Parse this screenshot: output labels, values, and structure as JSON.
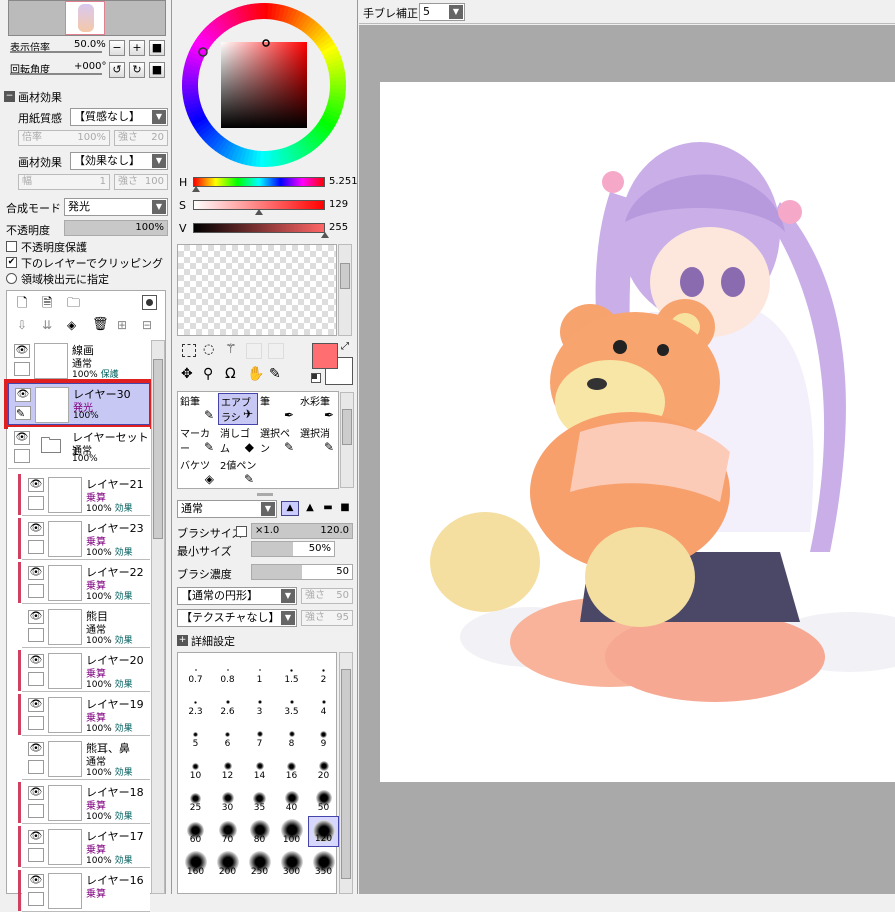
{
  "navigator": {
    "zoom_label": "表示倍率",
    "zoom_value": "50.0%",
    "rotate_label": "回転角度",
    "rotate_value": "+000°"
  },
  "texture": {
    "header": "画材効果",
    "paper_label": "用紙質感",
    "paper_value": "【質感なし】",
    "rate_label": "倍率",
    "rate_value": "100%",
    "strength_label": "強さ",
    "strength_value": "20",
    "effect_label": "画材効果",
    "effect_value": "【効果なし】",
    "width_label": "幅",
    "width_value": "1",
    "strength2_label": "強さ",
    "strength2_value": "100"
  },
  "layer_props": {
    "blend_label": "合成モード",
    "blend_value": "発光",
    "opacity_label": "不透明度",
    "opacity_value": "100%",
    "protect_opacity": "不透明度保護",
    "clip_lower": "下のレイヤーでクリッピング",
    "selection_source": "領域検出元に指定"
  },
  "layers": [
    {
      "name": "線画",
      "mode": "通常",
      "opacity": "100%",
      "extra": "保護"
    },
    {
      "name": "レイヤー30",
      "mode": "発光",
      "opacity": "100%",
      "extra": ""
    },
    {
      "name": "レイヤーセット1",
      "mode": "通常",
      "opacity": "100%",
      "extra": ""
    },
    {
      "name": "レイヤー21",
      "mode": "乗算",
      "opacity": "100%",
      "extra": "効果"
    },
    {
      "name": "レイヤー23",
      "mode": "乗算",
      "opacity": "100%",
      "extra": "効果"
    },
    {
      "name": "レイヤー22",
      "mode": "乗算",
      "opacity": "100%",
      "extra": "効果"
    },
    {
      "name": "熊目",
      "mode": "通常",
      "opacity": "100%",
      "extra": "効果"
    },
    {
      "name": "レイヤー20",
      "mode": "乗算",
      "opacity": "100%",
      "extra": "効果"
    },
    {
      "name": "レイヤー19",
      "mode": "乗算",
      "opacity": "100%",
      "extra": "効果"
    },
    {
      "name": "熊耳、鼻",
      "mode": "通常",
      "opacity": "100%",
      "extra": "効果"
    },
    {
      "name": "レイヤー18",
      "mode": "乗算",
      "opacity": "100%",
      "extra": "効果"
    },
    {
      "name": "レイヤー17",
      "mode": "乗算",
      "opacity": "100%",
      "extra": "効果"
    },
    {
      "name": "レイヤー16",
      "mode": "乗算",
      "opacity": "",
      "extra": ""
    }
  ],
  "color": {
    "h_label": "H",
    "h_value": "5.251",
    "h_level": 0.02,
    "s_label": "S",
    "s_value": "129",
    "s_level": 0.5,
    "v_label": "V",
    "v_value": "255",
    "v_level": 1.0,
    "fg_color": "#ff6f72",
    "bg_color": "#ffffff"
  },
  "tools": [
    {
      "label": "鉛筆",
      "icon": "pencil-icon",
      "glyph": "✎"
    },
    {
      "label": "エアブラシ",
      "icon": "airbrush-icon",
      "glyph": "✈"
    },
    {
      "label": "筆",
      "icon": "brush-icon",
      "glyph": "✒"
    },
    {
      "label": "水彩筆",
      "icon": "watercolor-icon",
      "glyph": "✒"
    },
    {
      "label": "マーカー",
      "icon": "marker-icon",
      "glyph": "✎"
    },
    {
      "label": "消しゴム",
      "icon": "eraser-icon",
      "glyph": "◆"
    },
    {
      "label": "選択ペン",
      "icon": "select-pen-icon",
      "glyph": "✎"
    },
    {
      "label": "選択消",
      "icon": "select-erase-icon",
      "glyph": "✎"
    },
    {
      "label": "バケツ",
      "icon": "bucket-icon",
      "glyph": "◈"
    },
    {
      "label": "2値ペン",
      "icon": "binary-pen-icon",
      "glyph": "✎"
    }
  ],
  "brush": {
    "mode_value": "通常",
    "size_label": "ブラシサイズ",
    "size_mult": "×1.0",
    "size_value": "120.0",
    "min_size_label": "最小サイズ",
    "min_size_value": "50%",
    "density_label": "ブラシ濃度",
    "density_value": "50",
    "shape_value": "【通常の円形】",
    "shape_strength_label": "強さ",
    "shape_strength_value": "50",
    "texture_value": "【テクスチャなし】",
    "texture_strength_label": "強さ",
    "texture_strength_value": "95",
    "detail_label": "詳細設定",
    "sizes": [
      "0.7",
      "0.8",
      "1",
      "1.5",
      "2",
      "2.3",
      "2.6",
      "3",
      "3.5",
      "4",
      "5",
      "6",
      "7",
      "8",
      "9",
      "10",
      "12",
      "14",
      "16",
      "20",
      "25",
      "30",
      "35",
      "40",
      "50",
      "60",
      "70",
      "80",
      "100",
      "120",
      "160",
      "200",
      "250",
      "300",
      "350"
    ],
    "selected_size": "120"
  },
  "canvas": {
    "stabilizer_label": "手ブレ補正",
    "stabilizer_value": "5"
  }
}
